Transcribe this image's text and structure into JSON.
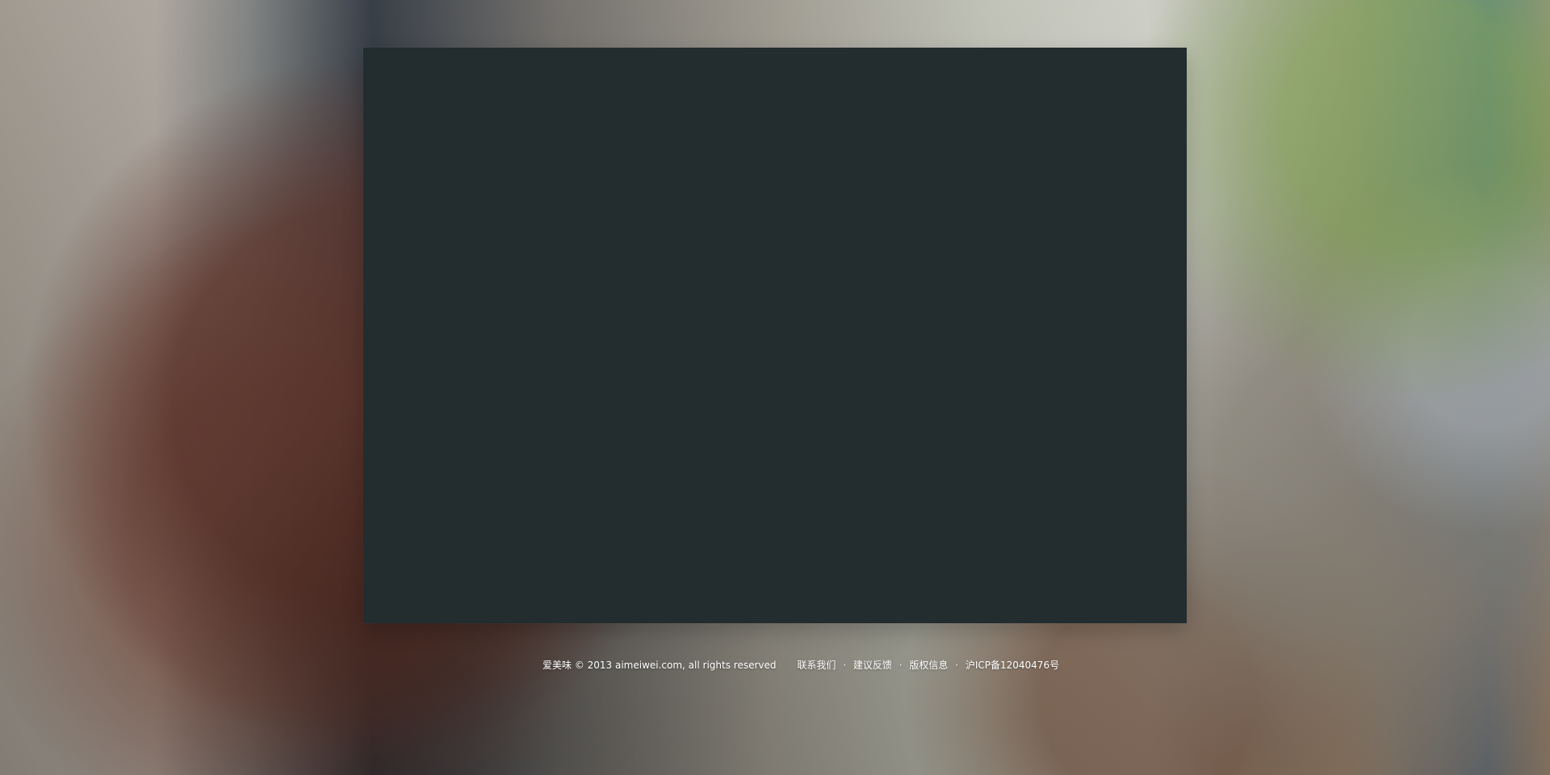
{
  "footer": {
    "copyright": "爱美味 © 2013 aimeiwei.com, all rights reserved",
    "links": [
      "联系我们",
      "建议反馈",
      "版权信息"
    ],
    "separator": "·",
    "icp": "沪ICP备12040476号"
  }
}
